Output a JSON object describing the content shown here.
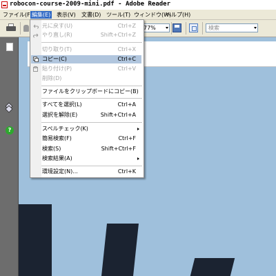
{
  "window": {
    "title": "robocon-course-2009-mini.pdf - Adobe Reader"
  },
  "menubar": {
    "items": [
      {
        "label": "ファイル(F)"
      },
      {
        "label": "編集(E)",
        "active": true
      },
      {
        "label": "表示(V)"
      },
      {
        "label": "文書(D)"
      },
      {
        "label": "ツール(T)"
      },
      {
        "label": "ウィンドウ(W)"
      },
      {
        "label": "ヘルプ(H)"
      }
    ]
  },
  "toolbar": {
    "zoom_value": "77%",
    "search_placeholder": "検索"
  },
  "nav": {
    "help_glyph": "?"
  },
  "edit_menu": {
    "items": [
      {
        "label": "元に戻す(U)",
        "shortcut": "Ctrl+Z",
        "enabled": false,
        "icon": "undo-icon"
      },
      {
        "label": "やり直し(R)",
        "shortcut": "Shift+Ctrl+Z",
        "enabled": false,
        "icon": "redo-icon"
      },
      {
        "label": "切り取り(T)",
        "shortcut": "Ctrl+X",
        "enabled": false
      },
      {
        "label": "コピー(C)",
        "shortcut": "Ctrl+C",
        "enabled": true,
        "highlighted": true,
        "icon": "copy-icon"
      },
      {
        "label": "貼り付け(P)",
        "shortcut": "Ctrl+V",
        "enabled": false,
        "icon": "paste-icon"
      },
      {
        "label": "削除(D)",
        "shortcut": "",
        "enabled": false
      },
      {
        "label": "ファイルをクリップボードにコピー(B)",
        "shortcut": "",
        "enabled": true
      },
      {
        "label": "すべてを選択(L)",
        "shortcut": "Ctrl+A",
        "enabled": true
      },
      {
        "label": "選択を解除(E)",
        "shortcut": "Shift+Ctrl+A",
        "enabled": true
      },
      {
        "label": "スペルチェック(K)",
        "shortcut": "",
        "enabled": true,
        "submenu": true
      },
      {
        "label": "簡易検索(F)",
        "shortcut": "Ctrl+F",
        "enabled": true
      },
      {
        "label": "検索(S)",
        "shortcut": "Shift+Ctrl+F",
        "enabled": true
      },
      {
        "label": "検索結果(A)",
        "shortcut": "",
        "enabled": true,
        "submenu": true
      },
      {
        "label": "環境設定(N)...",
        "shortcut": "Ctrl+K",
        "enabled": true
      }
    ]
  },
  "colors": {
    "document_background": "#9fc0dc",
    "menu_highlight": "#b1c6de",
    "menubar_active": "#316ac5",
    "gear_color": "#1b2331"
  }
}
